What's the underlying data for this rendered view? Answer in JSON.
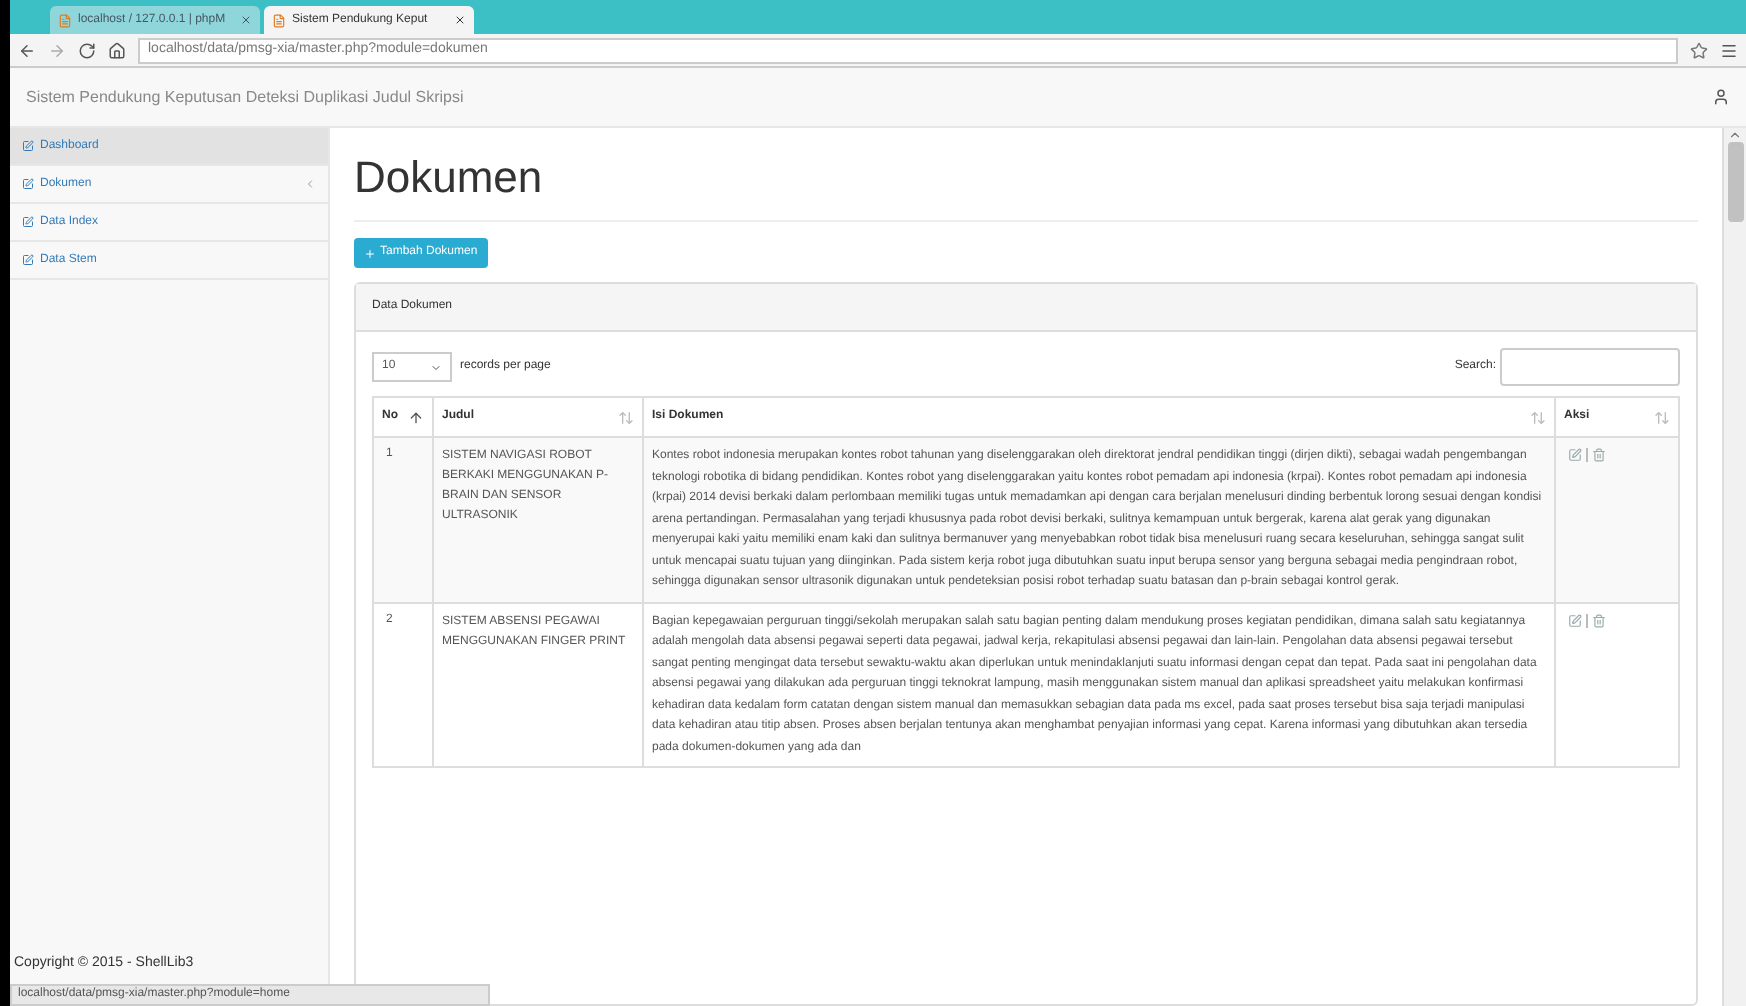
{
  "browser": {
    "tabs": [
      {
        "label": "localhost / 127.0.0.1 | phpM",
        "selected": false
      },
      {
        "label": "Sistem Pendukung Keput",
        "selected": true
      }
    ],
    "url": "localhost/data/pmsg-xia/master.php?module=dokumen"
  },
  "header": {
    "title": "Sistem Pendukung Keputusan Deteksi Duplikasi Judul Skripsi"
  },
  "sidebar": {
    "items": [
      {
        "label": "Dashboard",
        "selected": true,
        "has_submenu": false
      },
      {
        "label": "Dokumen",
        "selected": false,
        "has_submenu": true
      },
      {
        "label": "Data Index",
        "selected": false,
        "has_submenu": false
      },
      {
        "label": "Data Stem",
        "selected": false,
        "has_submenu": false
      }
    ]
  },
  "page": {
    "title": "Dokumen",
    "add_button": "Tambah Dokumen"
  },
  "panel": {
    "heading": "Data Dokumen",
    "page_size": "10",
    "page_size_label": "records per page",
    "search_label": "Search:"
  },
  "table": {
    "columns": [
      {
        "label": "No",
        "sorted": true
      },
      {
        "label": "Judul",
        "sorted": false
      },
      {
        "label": "Isi Dokumen",
        "sorted": false
      },
      {
        "label": "Aksi",
        "sorted": false
      }
    ],
    "rows": [
      {
        "no": "1",
        "judul": "SISTEM NAVIGASI ROBOT BERKAKI MENGGUNAKAN P-BRAIN DAN SENSOR ULTRASONIK",
        "isi": "Kontes robot indonesia merupakan kontes robot tahunan yang diselenggarakan oleh direktorat jendral pendidikan tinggi (dirjen dikti), sebagai wadah pengembangan teknologi robotika di bidang pendidikan. Kontes robot yang diselenggarakan yaitu kontes robot pemadam api indonesia (krpai). Kontes robot pemadam api indonesia (krpai) 2014 devisi berkaki dalam perlombaan memiliki tugas untuk memadamkan api dengan cara berjalan menelusuri dinding berbentuk lorong sesuai dengan kondisi arena pertandingan. Permasalahan yang terjadi khususnya pada robot devisi berkaki, sulitnya kemampuan untuk bergerak, karena alat gerak yang digunakan menyerupai kaki yaitu memiliki enam kaki dan sulitnya bermanuver yang menyebabkan robot tidak bisa menelusuri ruang secara keseluruhan, sehingga sangat sulit untuk mencapai suatu tujuan yang diinginkan. Pada sistem kerja robot juga dibutuhkan suatu input berupa sensor yang berguna sebagai media pengindraan robot, sehingga digunakan sensor ultrasonik digunakan untuk pendeteksian posisi robot terhadap suatu batasan dan p-brain sebagai kontrol gerak."
      },
      {
        "no": "2",
        "judul": "SISTEM ABSENSI PEGAWAI MENGGUNAKAN FINGER PRINT",
        "isi": "Bagian kepegawaian perguruan tinggi/sekolah merupakan salah satu bagian penting dalam mendukung proses kegiatan pendidikan, dimana salah satu kegiatannya adalah mengolah data absensi pegawai seperti data pegawai, jadwal kerja, rekapitulasi absensi pegawai dan lain-lain. Pengolahan data absensi pegawai tersebut sangat penting mengingat data tersebut sewaktu-waktu akan diperlukan untuk menindaklanjuti suatu informasi dengan cepat dan tepat. Pada saat ini pengolahan data absensi pegawai yang dilakukan ada perguruan tinggi teknokrat lampung, masih menggunakan sistem manual dan aplikasi spreadsheet yaitu melakukan konfirmasi kehadiran data kedalam form catatan dengan sistem manual dan memasukkan sebagian data pada ms excel, pada saat proses tersebut bisa saja terjadi manipulasi data kehadiran atau titip absen. Proses absen berjalan tentunya akan menghambat penyajian informasi yang cepat. Karena informasi yang dibutuhkan akan tersedia pada dokumen-dokumen yang ada dan"
      }
    ]
  },
  "footer": {
    "copyright": "Copyright © 2015 - ShellLib3"
  },
  "status_bar": "localhost/data/pmsg-xia/master.php?module=home"
}
